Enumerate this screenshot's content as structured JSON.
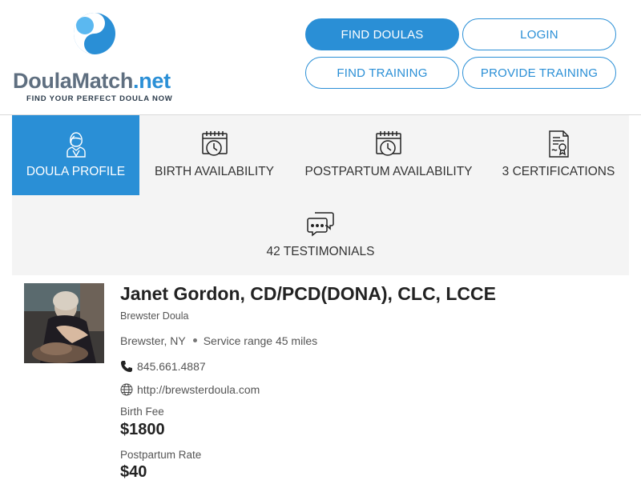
{
  "brand": {
    "name_part1": "Doula",
    "name_part2": "Match",
    "name_part3": ".net",
    "tagline": "FIND YOUR PERFECT DOULA NOW"
  },
  "nav": {
    "find_doulas": "FIND DOULAS",
    "login": "LOGIN",
    "find_training": "FIND TRAINING",
    "provide_training": "PROVIDE TRAINING"
  },
  "tabs": [
    {
      "label": "DOULA PROFILE",
      "icon": "doula-person-icon",
      "active": true
    },
    {
      "label": "BIRTH AVAILABILITY",
      "icon": "calendar-clock-icon",
      "active": false
    },
    {
      "label": "POSTPARTUM AVAILABILITY",
      "icon": "calendar-clock-icon",
      "active": false
    },
    {
      "label": "3 CERTIFICATIONS",
      "icon": "certificate-icon",
      "active": false
    },
    {
      "label": "42 TESTIMONIALS",
      "icon": "speech-bubbles-icon",
      "active": false
    }
  ],
  "profile": {
    "name": "Janet Gordon, CD/PCD(DONA), CLC, LCCE",
    "business": "Brewster Doula",
    "location": "Brewster, NY",
    "service_range": "Service range 45 miles",
    "phone": "845.661.4887",
    "website": "http://brewsterdoula.com",
    "birth_fee_label": "Birth Fee",
    "birth_fee": "$1800",
    "postpartum_label": "Postpartum Rate",
    "postpartum_rate": "$40"
  },
  "colors": {
    "accent": "#2a8fd6",
    "tab_bg": "#f4f4f4",
    "text_dark": "#222222",
    "text_muted": "#555555"
  }
}
